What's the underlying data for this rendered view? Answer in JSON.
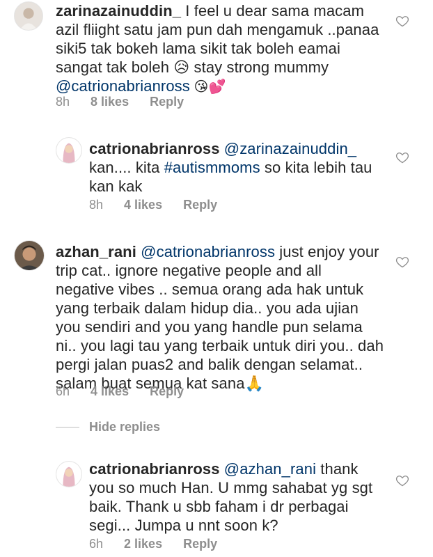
{
  "comments": [
    {
      "username": "zarinazainuddin_",
      "body": " I feel u dear sama macam azil fliight satu jam pun dah mengamuk ..panaa siki5 tak bokeh lama sikit tak boleh eamai sangat tak boleh 😥 stay strong mummy ",
      "mention": "@catrionabrianross",
      "trailing": " 😘💕",
      "time": "8h",
      "likes": "8 likes",
      "reply": "Reply"
    },
    {
      "username": "catrionabrianross",
      "mention": "@zarinazainuddin_",
      "body_before": "kan.... kita ",
      "hashtag": "#autismmoms",
      "body_after": " so kita lebih tau kan kak",
      "time": "8h",
      "likes": "4 likes",
      "reply": "Reply"
    },
    {
      "username": "azhan_rani",
      "mention": "@catrionabrianross",
      "body": " just enjoy your trip cat.. ignore negative people and all negative vibes .. semua orang ada hak untuk yang terbaik dalam hidup dia.. you ada ujian you sendiri and you yang handle pun selama ni.. you lagi tau yang terbaik untuk diri you.. dah pergi jalan puas2 and balik dengan selamat.. salam buat semua kat sana🙏",
      "time": "6h",
      "likes": "4 likes",
      "reply": "Reply"
    },
    {
      "username": "catrionabrianross",
      "mention": "@azhan_rani",
      "body": " thank you so much Han. U mmg sahabat yg sgt baik. Thank u sbb faham i dr perbagai segi... Jumpa u nnt soon k?",
      "time": "6h",
      "likes": "2 likes",
      "reply": "Reply"
    }
  ],
  "hide_replies": "Hide replies",
  "icons": {
    "like": "heart-outline-icon"
  },
  "colors": {
    "text": "#262626",
    "muted": "#8e8e8e",
    "link": "#003569"
  }
}
